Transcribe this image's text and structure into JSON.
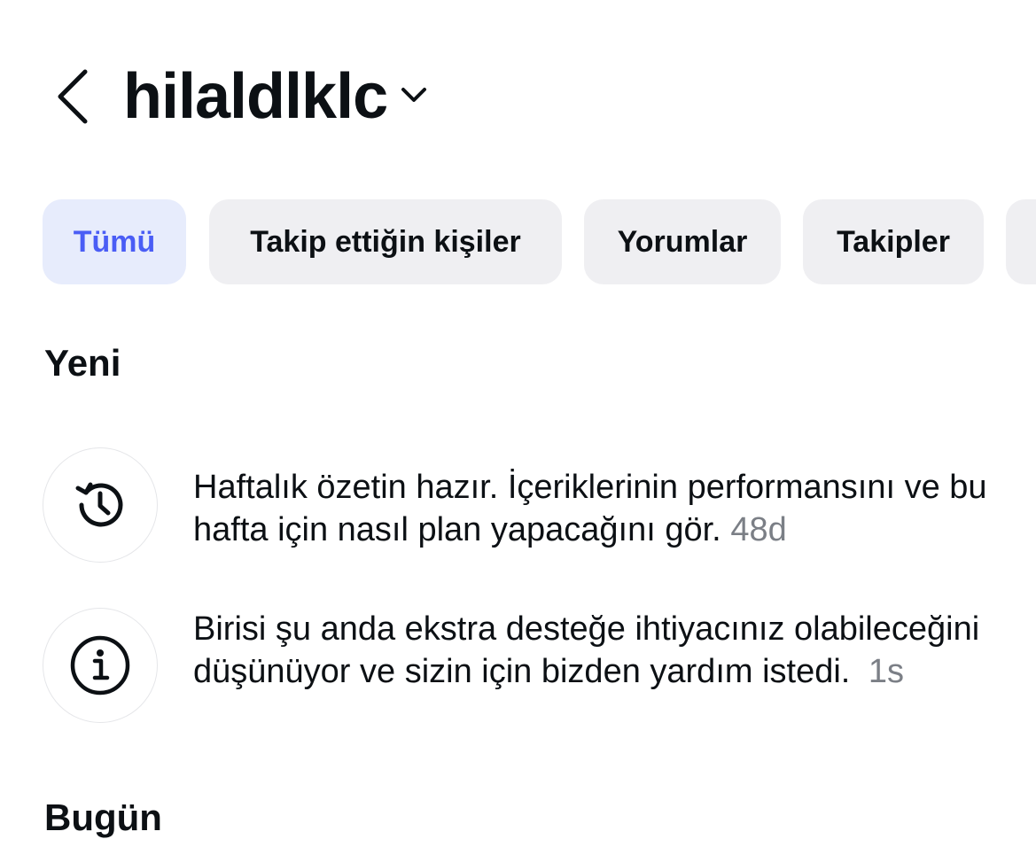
{
  "header": {
    "username": "hilaldlklc",
    "back_icon": "chevron-left-icon",
    "dropdown_icon": "chevron-down-icon"
  },
  "filters": {
    "chips": [
      {
        "label": "Tümü",
        "active": true
      },
      {
        "label": "Takip ettiğin kişiler",
        "active": false
      },
      {
        "label": "Yorumlar",
        "active": false
      },
      {
        "label": "Takipler",
        "active": false
      }
    ]
  },
  "sections": {
    "new_title": "Yeni",
    "today_title": "Bugün"
  },
  "notifications": [
    {
      "icon": "history-clock-icon",
      "text": "Haftalık özetin hazır. İçeriklerinin performansını ve bu hafta için nasıl plan yapacağını gör.",
      "time": "48d"
    },
    {
      "icon": "info-icon",
      "text": "Birisi şu anda ekstra desteğe ihtiyacınız olabileceğini düşünüyor ve sizin için bizden yardım istedi.",
      "time": "1s"
    }
  ],
  "colors": {
    "active_chip_bg": "#e7ecfc",
    "active_chip_text": "#4a5df5",
    "chip_bg": "#efeff2",
    "text_primary": "#0c1014",
    "text_secondary": "#7b7f86"
  }
}
